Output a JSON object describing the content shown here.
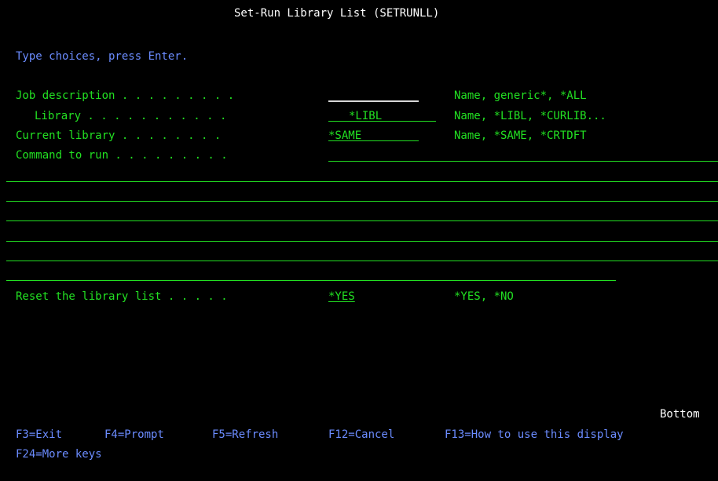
{
  "screen": {
    "title": "Set-Run Library List (SETRUNLL)",
    "instruction": "Type choices, press Enter.",
    "bottom_marker": "Bottom"
  },
  "fields": {
    "job_description": {
      "label": "Job description . . . . . . . . .",
      "value": "",
      "hint": "Name, generic*, *ALL"
    },
    "library": {
      "label": "Library . . . . . . . . . . .",
      "value": "*LIBL",
      "hint": "Name, *LIBL, *CURLIB..."
    },
    "current_library": {
      "label": "Current library . . . . . . . .",
      "value": "*SAME",
      "hint": "Name, *SAME, *CRTDFT"
    },
    "command_to_run": {
      "label": "Command to run . . . . . . . . .",
      "value": ""
    },
    "reset_library_list": {
      "label": "Reset the library list . . . . .",
      "value": "*YES",
      "hint": "*YES, *NO"
    }
  },
  "function_keys": {
    "f3": "F3=Exit",
    "f4": "F4=Prompt",
    "f5": "F5=Refresh",
    "f12": "F12=Cancel",
    "f13": "F13=How to use this display",
    "f24": "F24=More keys"
  },
  "colors": {
    "background": "#000000",
    "title": "#ffffff",
    "instruction": "#6b8cff",
    "field_text": "#22e022"
  }
}
